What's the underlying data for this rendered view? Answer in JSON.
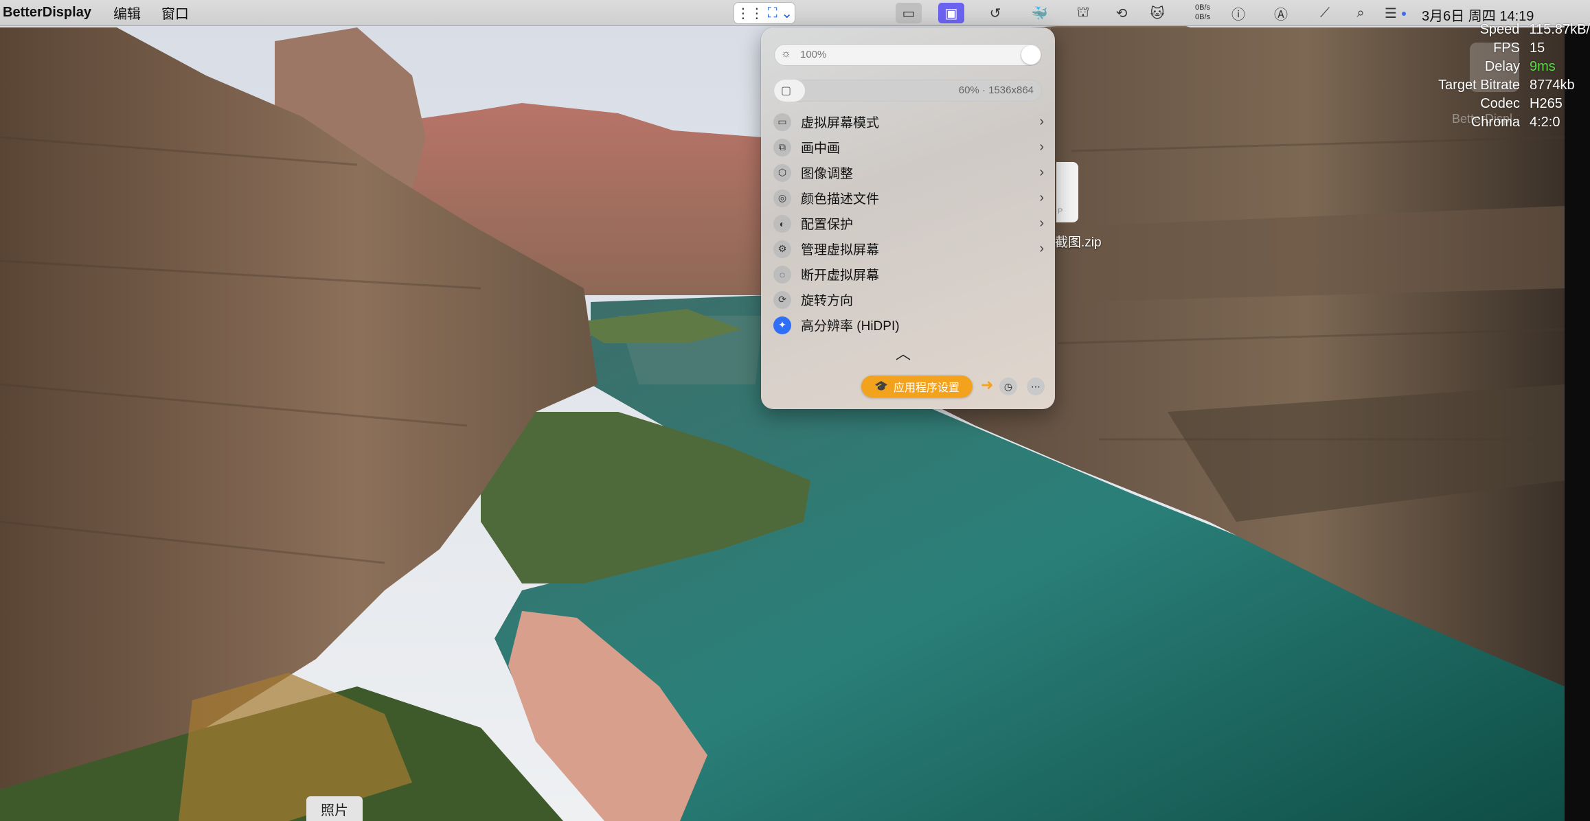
{
  "menubar": {
    "app_name": "BetterDisplay",
    "menus": [
      "编辑",
      "窗口"
    ],
    "selection_tool_icons": [
      "select-icon",
      "chevron-down-icon"
    ],
    "status_icons": [
      "display-icon",
      "virtual-screen-icon",
      "history-icon",
      "docker-icon",
      "extension-icon",
      "sync-icon",
      "cat-icon",
      "info-icon",
      "input-a-icon",
      "wifi-off-icon",
      "search-icon",
      "control-center-icon"
    ],
    "net_up": "0B/s",
    "net_down": "0B/s",
    "clock": "3月6日 周四  14:19"
  },
  "stats": [
    {
      "key": "Speed",
      "value": "115.87kB/"
    },
    {
      "key": "FPS",
      "value": "15"
    },
    {
      "key": "Delay",
      "value": "9ms",
      "color": "#5ddc4b"
    },
    {
      "key": "Target Bitrate",
      "value": "8774kb"
    },
    {
      "key": "Codec",
      "value": "H265"
    },
    {
      "key": "Chroma",
      "value": "4:2:0"
    }
  ],
  "stats_ghost": "BetterDispl",
  "desktop_file": {
    "label": "截图.zip",
    "icon_tag": "P"
  },
  "panel": {
    "brightness": {
      "label": "100%",
      "value": 1.0
    },
    "resolution": {
      "label": "60% · 1536x864",
      "value": 0.6
    },
    "items": [
      {
        "label": "虚拟屏幕模式",
        "icon": "virtual-screen-mode-icon",
        "glyph": "▭",
        "chevron": true
      },
      {
        "label": "画中画",
        "icon": "picture-in-picture-icon",
        "glyph": "⧉",
        "chevron": true
      },
      {
        "label": "图像调整",
        "icon": "image-adjust-icon",
        "glyph": "⬡",
        "chevron": true
      },
      {
        "label": "颜色描述文件",
        "icon": "color-profile-icon",
        "glyph": "◎",
        "chevron": true
      },
      {
        "label": "配置保护",
        "icon": "protection-icon",
        "glyph": "◐",
        "chevron": true
      },
      {
        "label": "管理虚拟屏幕",
        "icon": "manage-screens-icon",
        "glyph": "⚙",
        "chevron": true
      },
      {
        "label": "断开虚拟屏幕",
        "icon": "disconnect-icon",
        "glyph": "◌",
        "chevron": false
      },
      {
        "label": "旋转方向",
        "icon": "rotate-icon",
        "glyph": "⟳",
        "chevron": false
      },
      {
        "label": "高分辨率 (HiDPI)",
        "icon": "hidpi-icon",
        "glyph": "✦",
        "chevron": false,
        "accent": "#2f6ff5"
      }
    ],
    "app_settings_label": "应用程序设置",
    "accent": "#f3a21d"
  },
  "dock_tooltip": "照片"
}
